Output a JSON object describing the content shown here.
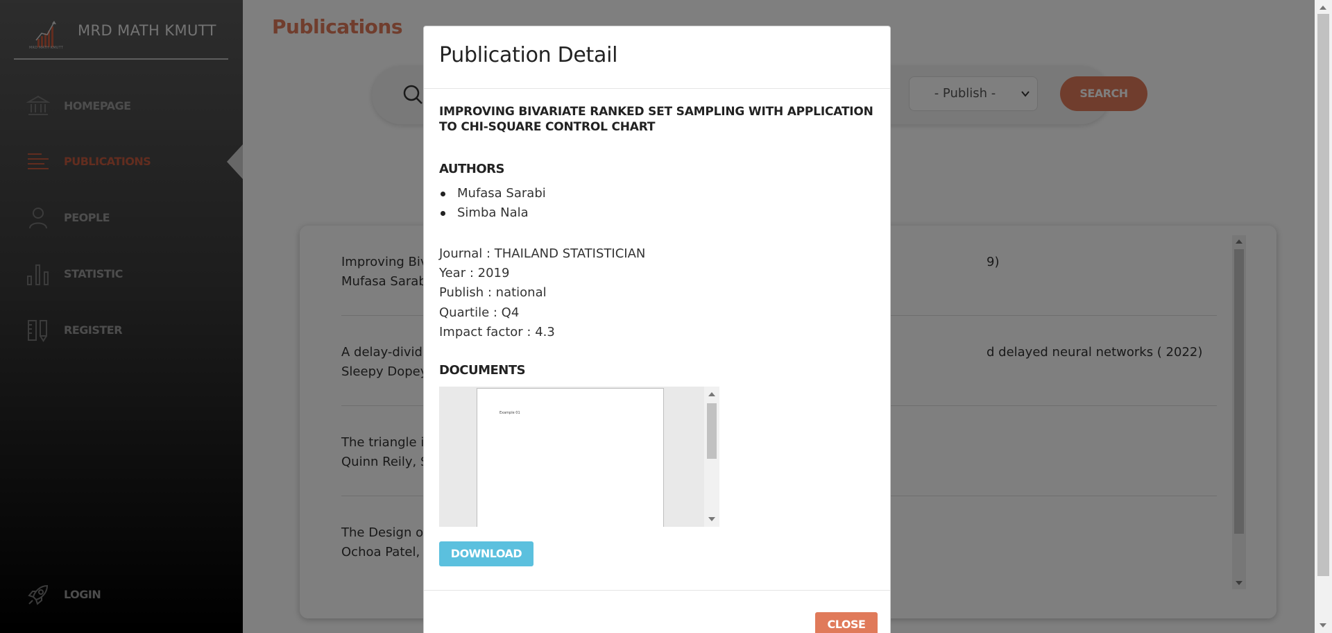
{
  "brand": {
    "title": "MRD MATH KMUTT",
    "logo_text": "MRD MATH KMUTT"
  },
  "sidebar": {
    "items": [
      {
        "label": "HOMEPAGE",
        "icon": "bank-icon",
        "active": false
      },
      {
        "label": "PUBLICATIONS",
        "icon": "list-icon",
        "active": true
      },
      {
        "label": "PEOPLE",
        "icon": "person-icon",
        "active": false
      },
      {
        "label": "STATISTIC",
        "icon": "bar-chart-icon",
        "active": false
      },
      {
        "label": "REGISTER",
        "icon": "ruler-pencil-icon",
        "active": false
      }
    ],
    "login_label": "LOGIN"
  },
  "main": {
    "page_title": "Publications",
    "search": {
      "publish_select": "- Publish -",
      "button_label": "SEARCH"
    },
    "results": [
      {
        "title": "Improving Biv",
        "title_end": "9)",
        "authors": "Mufasa Sarab"
      },
      {
        "title": "A delay-dividi",
        "title_end": "d delayed neural networks ( 2022)",
        "authors": "Sleepy Dopey"
      },
      {
        "title": "The triangle ir",
        "title_end": "",
        "authors": "Quinn Reily, S"
      },
      {
        "title": "The Design of",
        "title_end": "",
        "authors": "Ochoa Patel, "
      }
    ]
  },
  "modal": {
    "title": "Publication Detail",
    "publication_title": "IMPROVING BIVARIATE RANKED SET SAMPLING WITH APPLICATION TO CHI-SQUARE CONTROL CHART",
    "authors_heading": "AUTHORS",
    "authors": [
      "Mufasa Sarabi",
      "Simba Nala"
    ],
    "info": {
      "journal": "Journal : THAILAND STATISTICIAN",
      "year": "Year : 2019",
      "publish": "Publish : national",
      "quartile": "Quartile : Q4",
      "impact_factor": "Impact factor : 4.3"
    },
    "documents_heading": "DOCUMENTS",
    "document_preview_text": "Example 01",
    "download_label": "DOWNLOAD",
    "close_label": "CLOSE"
  },
  "colors": {
    "accent": "#e07a5a",
    "active_nav": "#c45a3e",
    "download": "#5bc0de"
  }
}
